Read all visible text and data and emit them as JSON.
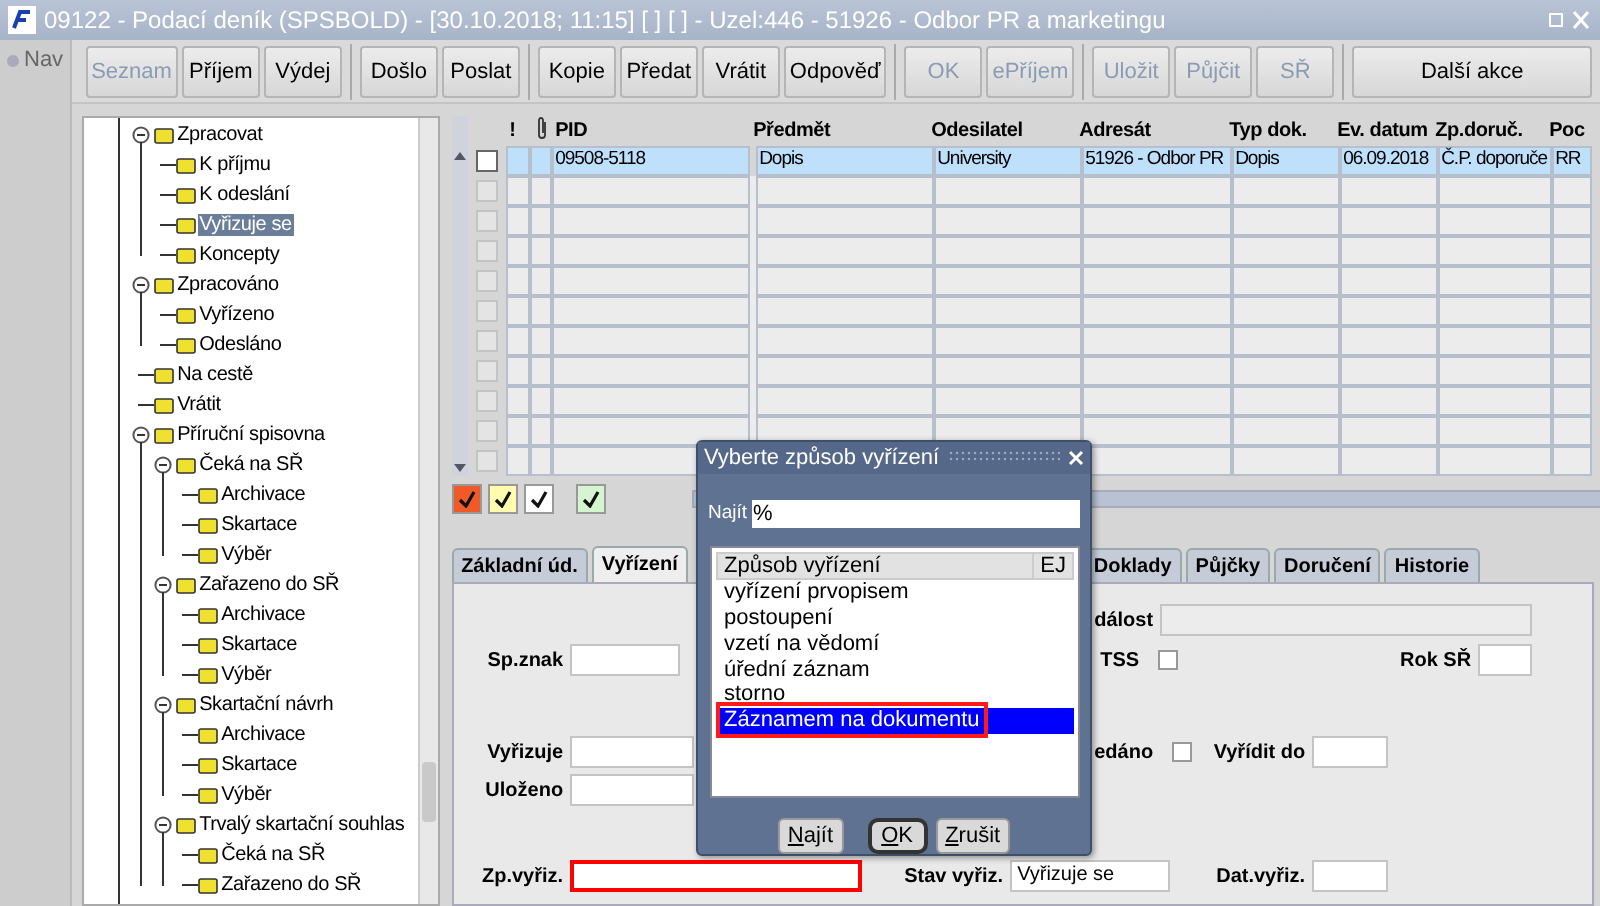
{
  "window": {
    "title": "09122 - Podací deník (SPSBOLD) - [30.10.2018; 11:15]  [ ]  [ ] - Uzel:446 - 51926 - Odbor PR a marketingu"
  },
  "nav": {
    "label": "Nav"
  },
  "toolbar": {
    "groups": [
      [
        {
          "label": "Seznam",
          "disabled": true
        },
        {
          "label": "Příjem",
          "disabled": false
        },
        {
          "label": "Výdej",
          "disabled": false
        }
      ],
      [
        {
          "label": "Došlo",
          "disabled": false
        },
        {
          "label": "Poslat",
          "disabled": false
        }
      ],
      [
        {
          "label": "Kopie",
          "disabled": false
        },
        {
          "label": "Předat",
          "disabled": false
        },
        {
          "label": "Vrátit",
          "disabled": false
        },
        {
          "label": "Odpověď",
          "disabled": false
        }
      ],
      [
        {
          "label": "OK",
          "disabled": true
        },
        {
          "label": "ePříjem",
          "disabled": true
        }
      ],
      [
        {
          "label": "Uložit",
          "disabled": true
        },
        {
          "label": "Půjčit",
          "disabled": true
        },
        {
          "label": "SŘ",
          "disabled": true
        }
      ],
      [
        {
          "label": "Další akce",
          "disabled": false
        }
      ]
    ]
  },
  "tree": {
    "items": [
      {
        "label": "Zpracovat",
        "selected": false,
        "expanded": true,
        "children": [
          {
            "label": "K příjmu",
            "selected": false
          },
          {
            "label": "K odeslání",
            "selected": false
          },
          {
            "label": "Vyřizuje se",
            "selected": true
          },
          {
            "label": "Koncepty",
            "selected": false
          }
        ]
      },
      {
        "label": "Zpracováno",
        "selected": false,
        "expanded": true,
        "children": [
          {
            "label": "Vyřízeno",
            "selected": false
          },
          {
            "label": "Odesláno",
            "selected": false
          }
        ]
      },
      {
        "label": "Na cestě",
        "selected": false
      },
      {
        "label": "Vrátit",
        "selected": false
      },
      {
        "label": "Příruční spisovna",
        "selected": false,
        "expanded": true,
        "children": [
          {
            "label": "Čeká na SŘ",
            "selected": false,
            "expanded": true,
            "children": [
              {
                "label": "Archivace",
                "selected": false
              },
              {
                "label": "Skartace",
                "selected": false
              },
              {
                "label": "Výběr",
                "selected": false
              }
            ]
          },
          {
            "label": "Zařazeno do SŘ",
            "selected": false,
            "expanded": true,
            "children": [
              {
                "label": "Archivace",
                "selected": false
              },
              {
                "label": "Skartace",
                "selected": false
              },
              {
                "label": "Výběr",
                "selected": false
              }
            ]
          },
          {
            "label": "Skartační návrh",
            "selected": false,
            "expanded": true,
            "children": [
              {
                "label": "Archivace",
                "selected": false
              },
              {
                "label": "Skartace",
                "selected": false
              },
              {
                "label": "Výběr",
                "selected": false
              }
            ]
          },
          {
            "label": "Trvalý skartační souhlas",
            "selected": false,
            "expanded": true,
            "children": [
              {
                "label": "Čeká na SŘ",
                "selected": false
              },
              {
                "label": "Zařazeno do SŘ",
                "selected": false
              }
            ]
          }
        ]
      }
    ]
  },
  "table": {
    "columns": [
      {
        "kind": "text",
        "label": "!"
      },
      {
        "kind": "attachment"
      },
      {
        "kind": "text",
        "label": "PID"
      },
      {
        "kind": "text",
        "label": "Předmět"
      },
      {
        "kind": "text",
        "label": "Odesilatel"
      },
      {
        "kind": "text",
        "label": "Adresát"
      },
      {
        "kind": "text",
        "label": "Typ dok."
      },
      {
        "kind": "text",
        "label": "Ev. datum"
      },
      {
        "kind": "text",
        "label": "Zp.doruč."
      },
      {
        "kind": "text",
        "label": "Poc"
      }
    ],
    "rows": [
      {
        "selected": true,
        "checked": false,
        "cells": [
          "09508-5118",
          "Dopis",
          "University",
          "51926 - Odbor PR",
          "Dopis",
          "06.09.2018",
          "Č.P. doporuče",
          "RR"
        ]
      },
      {
        "selected": false,
        "checked": false
      },
      {
        "selected": false,
        "checked": false
      },
      {
        "selected": false,
        "checked": false
      },
      {
        "selected": false,
        "checked": false
      },
      {
        "selected": false,
        "checked": false
      },
      {
        "selected": false,
        "checked": false
      },
      {
        "selected": false,
        "checked": false
      },
      {
        "selected": false,
        "checked": false
      },
      {
        "selected": false,
        "checked": false
      },
      {
        "selected": false,
        "checked": false
      }
    ]
  },
  "legend_checkboxes": [
    {
      "color": "#f05a28",
      "checked": true
    },
    {
      "color": "#fffcb0",
      "checked": true
    },
    {
      "color": "#ffffff",
      "checked": true
    },
    {
      "color": "#d4f5cf",
      "checked": true
    }
  ],
  "tabs": [
    {
      "label": "Základní úd.",
      "selected": false
    },
    {
      "label": "Vyřízení",
      "selected": true
    },
    {
      "label": "Doklady",
      "selected": false
    },
    {
      "label": "Půjčky",
      "selected": false
    },
    {
      "label": "Doručení",
      "selected": false
    },
    {
      "label": "Historie",
      "selected": false
    }
  ],
  "form": {
    "fields": [
      {
        "kind": "field",
        "label": "dálost"
      },
      {
        "kind": "field",
        "label": "Sp.znak"
      },
      {
        "kind": "checkbox",
        "label": "TSS",
        "checked": false
      },
      {
        "kind": "field",
        "label": "Rok SŘ"
      },
      {
        "kind": "field",
        "label": "Vyřizuje"
      },
      {
        "kind": "checkbox",
        "label": "edáno",
        "checked": false
      },
      {
        "kind": "field",
        "label": "Vyřídit do"
      },
      {
        "kind": "field",
        "label": "Uloženo"
      },
      {
        "kind": "field",
        "label": "Zp.vyřiz.",
        "highlighted": true
      },
      {
        "kind": "field",
        "label": "Stav vyřiz.",
        "value": "Vyřizuje se"
      },
      {
        "kind": "field",
        "label": "Dat.vyřiz."
      }
    ]
  },
  "dialog": {
    "title": "Vyberte způsob vyřízení",
    "search_label": "Najít",
    "search_value": "%",
    "list": {
      "columns": [
        "Způsob vyřízení",
        "EJ"
      ],
      "items": [
        {
          "label": "vyřízení prvopisem",
          "selected": false
        },
        {
          "label": "postoupení",
          "selected": false
        },
        {
          "label": "vzetí na vědomí",
          "selected": false
        },
        {
          "label": "úřední záznam",
          "selected": false
        },
        {
          "label": "storno",
          "selected": false
        },
        {
          "label": "Záznamem na dokumentu",
          "selected": true,
          "highlighted": true
        }
      ]
    },
    "buttons": [
      {
        "label": "Najít",
        "focused": false
      },
      {
        "label": "OK",
        "focused": true
      },
      {
        "label": "Zrušit",
        "focused": false
      }
    ]
  }
}
